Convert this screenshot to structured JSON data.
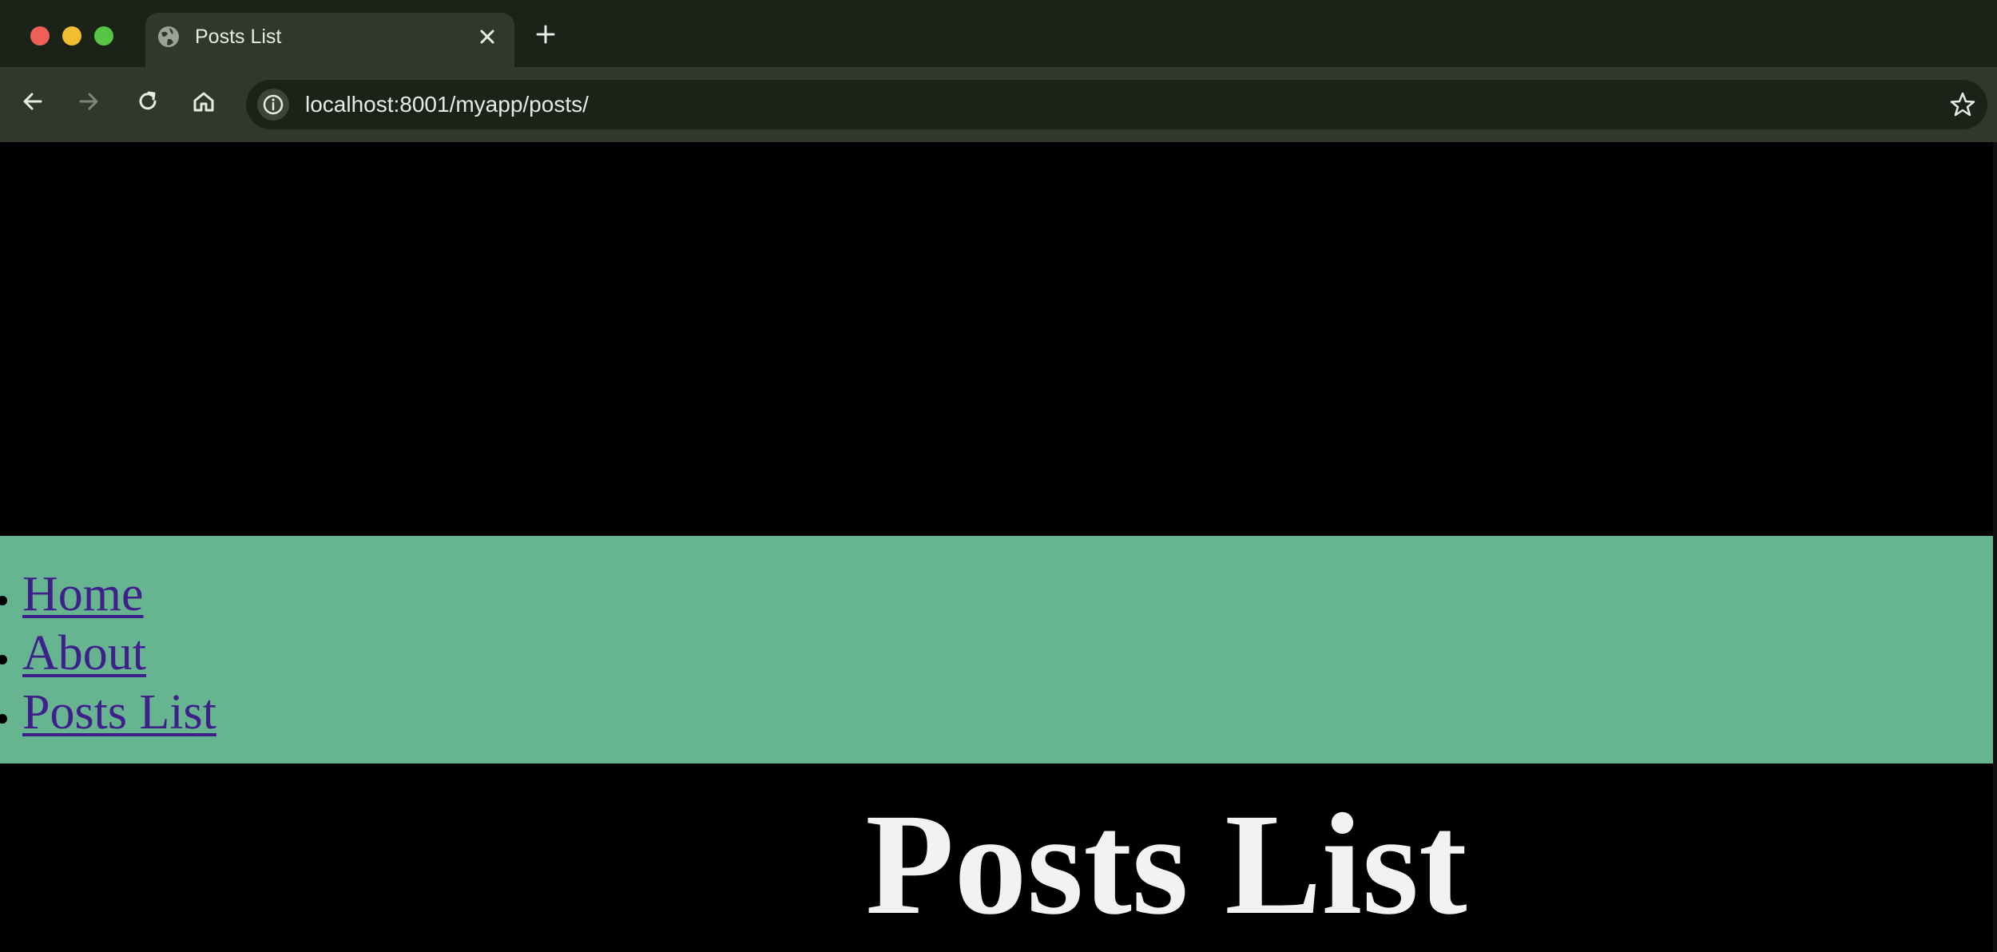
{
  "browser": {
    "tab": {
      "title": "Posts List",
      "favicon": "globe-icon",
      "close_icon": "close-icon"
    },
    "new_tab_icon": "plus-icon",
    "toolbar": {
      "back_icon": "arrow-left-icon",
      "forward_icon": "arrow-right-icon",
      "reload_icon": "reload-icon",
      "home_icon": "home-icon",
      "site_info_icon": "info-icon",
      "bookmark_icon": "star-icon"
    },
    "address_bar": {
      "url": "localhost:8001/myapp/posts/"
    },
    "colors": {
      "frame": "#1b2217",
      "active_tab": "#2f382b"
    }
  },
  "page": {
    "nav": {
      "items": [
        {
          "label": "Home"
        },
        {
          "label": "About"
        },
        {
          "label": "Posts List"
        }
      ],
      "background": "#67b590",
      "link_color": "#3f1f8a"
    },
    "heading": "Posts List",
    "background": "#000000"
  }
}
